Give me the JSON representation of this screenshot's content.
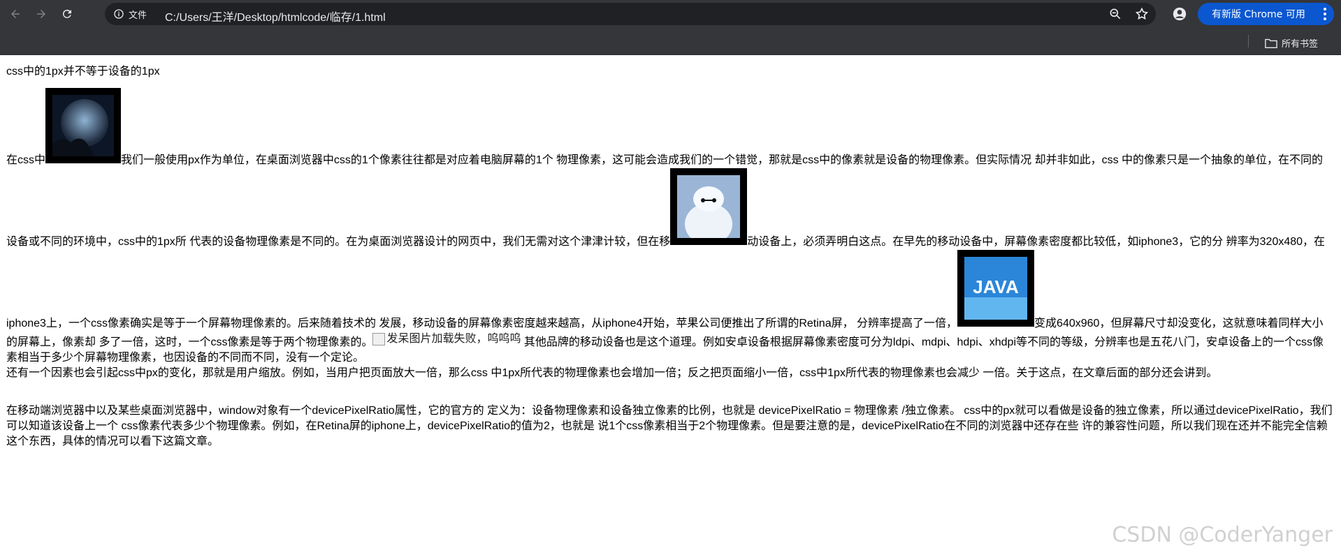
{
  "browser": {
    "back_icon": "arrow-left-icon",
    "forward_icon": "arrow-right-icon",
    "reload_icon": "reload-icon",
    "site_info_label": "文件",
    "url": "C:/Users/王洋/Desktop/htmlcode/临存/1.html",
    "update_label": "有新版 Chrome 可用",
    "bookmarks_label": "所有书签"
  },
  "article": {
    "title": "css中的1px并不等于设备的1px",
    "p1": {
      "part1": "在css中",
      "part2": "我们一般使用px作为单位，在桌面浏览器中css的1个像素往往都是对应着电脑屏幕的1个 物理像素，这可能会造成我们的一个错觉，那就是css中的像素就是设备的物理像素。但实际情况 却并非如此，css 中的像素只是一个抽象的单位，在不同的设备或不同的环境中，css中的1px所 代表的设备物理像素是不同的。在为桌面浏览器设计的网页中，我们无需对这个津津计较，但在移",
      "part3": "动设备上，必须弄明白这点。在早先的移动设备中，屏幕像素密度都比较低，如iphone3，它的分 辨率为320x480，在iphone3上，一个css像素确实是等于一个屏幕物理像素的。后来随着技术的 发展，移动设备的屏幕像素密度越来越高，从iphone4开始，苹果公司便推出了所谓的Retina屏， 分辨率提高了一倍，",
      "part4": "变成640x960，但屏幕尺寸却没变化，这就意味着同样大小的屏幕上，像素却 多了一倍，这时，一个css像素是等于两个物理像素的。",
      "broken_image_alt": "发呆图片加载失败，呜呜呜",
      "part5": " 其他品牌的移动设备也是这个道理。例如安卓设备根据屏幕像素密度可分为ldpi、mdpi、hdpi、xhdpi等不同的等级，分辨率也是五花八门，安卓设备上的一个css像素相当于多少个屏幕物理像素，也因设备的不同而不同，没有一个定论。"
    },
    "p2": "还有一个因素也会引起css中px的变化，那就是用户缩放。例如，当用户把页面放大一倍，那么css 中1px所代表的物理像素也会增加一倍；反之把页面缩小一倍，css中1px所代表的物理像素也会减少 一倍。关于这点，在文章后面的部分还会讲到。",
    "p3": "在移动端浏览器中以及某些桌面浏览器中，window对象有一个devicePixelRatio属性，它的官方的 定义为：设备物理像素和设备独立像素的比例，也就是 devicePixelRatio = 物理像素 /独立像素。 css中的px就可以看做是设备的独立像素，所以通过devicePixelRatio，我们可以知道该设备上一个 css像素代表多少个物理像素。例如，在Retina屏的iphone上，devicePixelRatio的值为2，也就是 说1个css像素相当于2个物理像素。但是要注意的是，devicePixelRatio在不同的浏览器中还存在些 许的兼容性问题，所以我们现在还并不能完全信赖这个东西，具体的情况可以看下这篇文章。",
    "java_image_text": "JAVA"
  },
  "watermark": "CSDN @CoderYanger"
}
